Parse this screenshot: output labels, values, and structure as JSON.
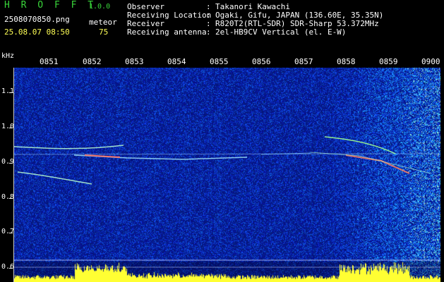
{
  "header": {
    "brand": "H R O F F T",
    "version": "1.0.0",
    "filename": "2508070850.png",
    "datetime": "25.08.07 08:50",
    "meteor_label": "meteor",
    "meteor_count": "75"
  },
  "info": [
    {
      "label": "Observer",
      "value": "Takanori Kawachi"
    },
    {
      "label": "Receiving Location",
      "value": "Ogaki, Gifu, JAPAN (136.60E, 35.35N)"
    },
    {
      "label": "Receiver",
      "value": "R820T2(RTL-SDR) SDR-Sharp 53.372MHz"
    },
    {
      "label": "Receiving antenna",
      "value": "2el-HB9CV Vertical (el. E-W)"
    }
  ],
  "separator": ":",
  "spectrogram": {
    "y_unit": "kHz",
    "y_ticks": [
      "1.1",
      "1.0",
      "0.9",
      "0.8",
      "0.7",
      "0.6"
    ],
    "x_ticks": [
      "0851",
      "0852",
      "0853",
      "0854",
      "0855",
      "0856",
      "0857",
      "0858",
      "0859",
      "0900"
    ],
    "colors": {
      "background": "#000000",
      "noise_low": "#08108a",
      "noise_high": "#2a6cff",
      "signal": "#c8ffb0",
      "level_bar": "#ffff33",
      "brand_green": "#39d53a"
    }
  }
}
